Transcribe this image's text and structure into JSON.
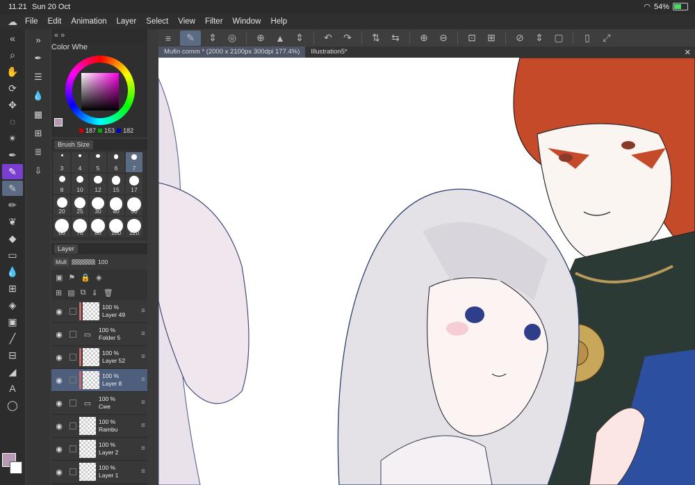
{
  "status": {
    "time": "11.21",
    "date": "Sun 20 Oct",
    "battery": "54%"
  },
  "menu": [
    "File",
    "Edit",
    "Animation",
    "Layer",
    "Select",
    "View",
    "Filter",
    "Window",
    "Help"
  ],
  "tabs": [
    "Mufin comm * (2000 x 2100px 300dpi 177.4%)",
    "Illustration5*"
  ],
  "color_wheel": {
    "title": "Color Whe",
    "r": "187",
    "g": "153",
    "b": "182"
  },
  "brush_size": {
    "title": "Brush Size",
    "sizes": [
      "3",
      "4",
      "5",
      "6",
      "7",
      "8",
      "10",
      "12",
      "15",
      "17",
      "20",
      "25",
      "30",
      "40",
      "50",
      "60",
      "70",
      "80",
      "100",
      "120"
    ],
    "selected": "7"
  },
  "layer_panel": {
    "title": "Layer",
    "blend": "Mult",
    "opacity": "100",
    "layers": [
      {
        "pct": "100 %",
        "name": "Layer 49",
        "extra": "I"
      },
      {
        "pct": "100 %",
        "name": "Folder 5",
        "extra": ""
      },
      {
        "pct": "100 %",
        "name": "Layer 52",
        "extra": "I"
      },
      {
        "pct": "100 %",
        "name": "Layer 8",
        "extra": "I"
      },
      {
        "pct": "100 %",
        "name": "Cwe",
        "extra": ""
      },
      {
        "pct": "100 %",
        "name": "Rambu",
        "extra": ""
      },
      {
        "pct": "100 %",
        "name": "Layer 2",
        "extra": ""
      },
      {
        "pct": "100 %",
        "name": "Layer 1",
        "extra": ""
      }
    ]
  }
}
